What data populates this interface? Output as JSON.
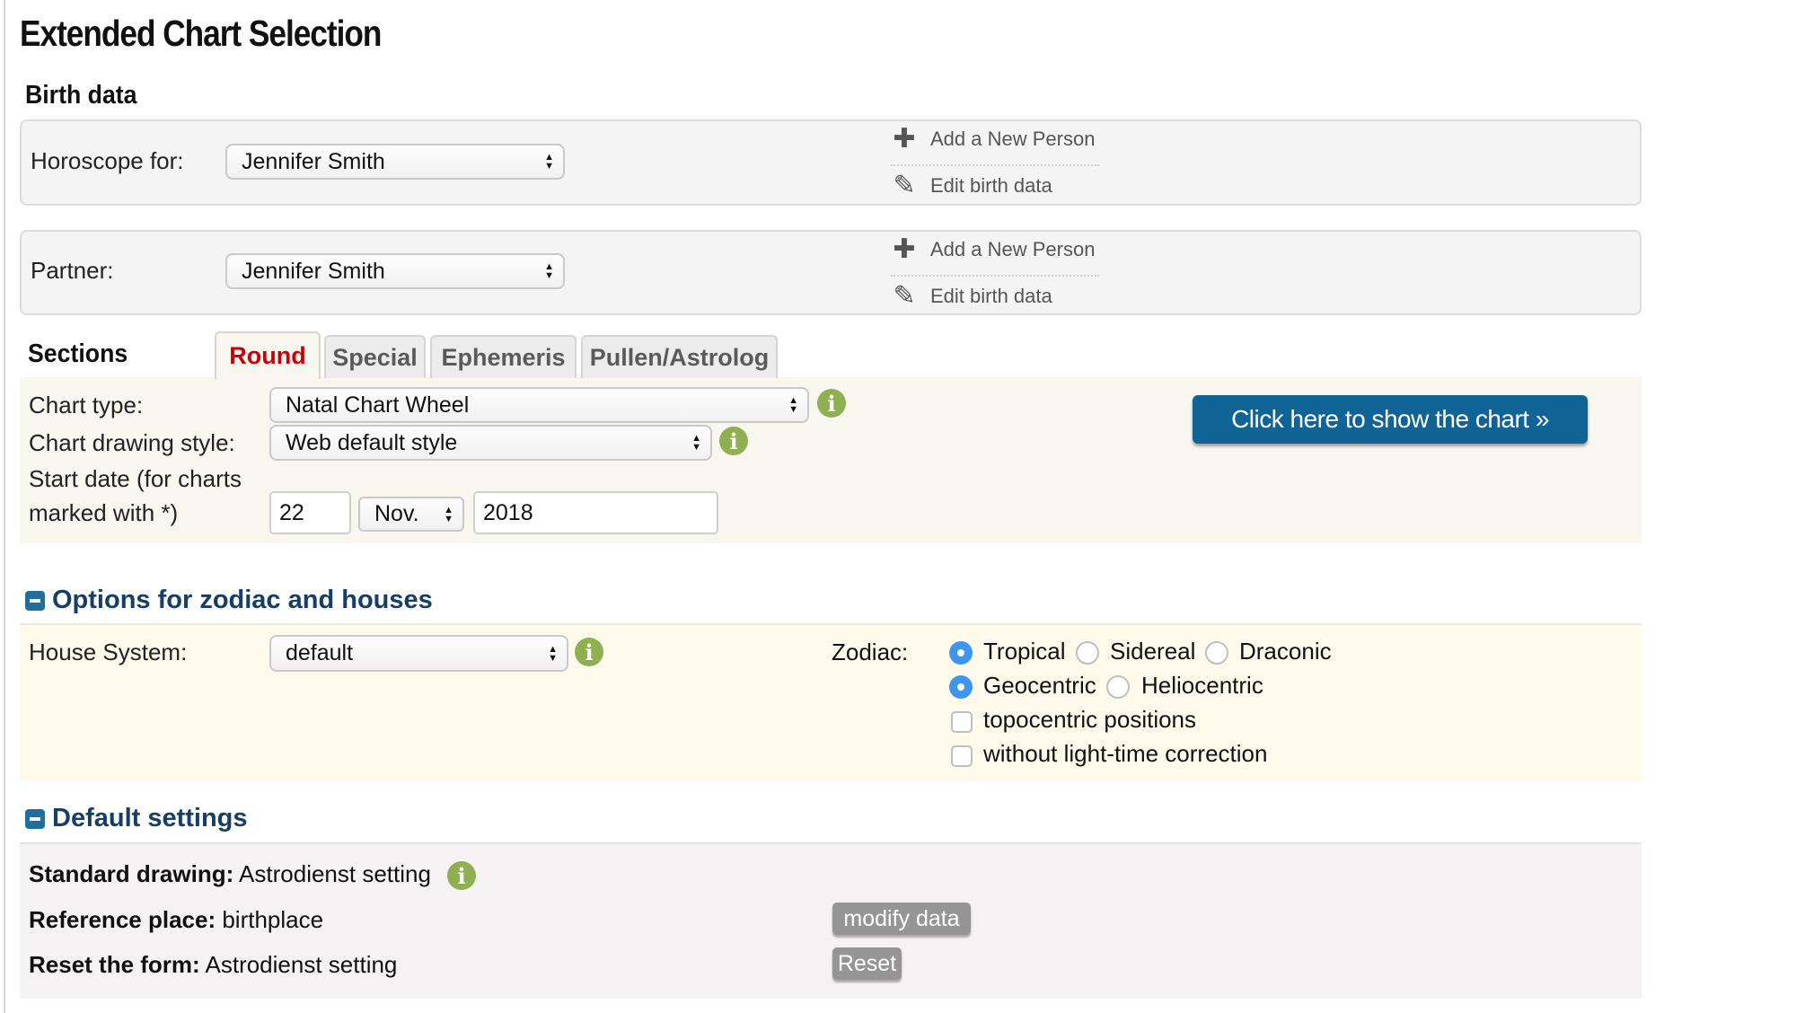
{
  "page": {
    "title": "Extended Chart Selection"
  },
  "birth_data": {
    "heading": "Birth data",
    "horoscope": {
      "label": "Horoscope for:",
      "value": "Jennifer Smith",
      "add_person": "Add a New Person",
      "edit": "Edit birth data"
    },
    "partner": {
      "label": "Partner:",
      "value": "Jennifer Smith",
      "add_person": "Add a New Person",
      "edit": "Edit birth data"
    }
  },
  "sections": {
    "label": "Sections",
    "tabs": [
      {
        "label": "Round",
        "active": true
      },
      {
        "label": "Special",
        "active": false
      },
      {
        "label": "Ephemeris",
        "active": false
      },
      {
        "label": "Pullen/Astrolog",
        "active": false
      }
    ],
    "chart_type": {
      "label": "Chart type:",
      "value": "Natal Chart Wheel"
    },
    "drawing_style": {
      "label": "Chart drawing style:",
      "value": "Web default style"
    },
    "start_date": {
      "label_line1": "Start date (for charts",
      "label_line2": "marked with *)",
      "day": "22",
      "month": "Nov.",
      "year": "2018"
    },
    "show_button": "Click here to show the chart »"
  },
  "zodiac_options": {
    "heading": "Options for zodiac and houses",
    "house_system": {
      "label": "House System:",
      "value": "default"
    },
    "zodiac_label": "Zodiac:",
    "zodiac_type": [
      {
        "label": "Tropical",
        "checked": true
      },
      {
        "label": "Sidereal",
        "checked": false
      },
      {
        "label": "Draconic",
        "checked": false
      }
    ],
    "centric": [
      {
        "label": "Geocentric",
        "checked": true
      },
      {
        "label": "Heliocentric",
        "checked": false
      }
    ],
    "checkboxes": [
      {
        "label": "topocentric positions",
        "checked": false
      },
      {
        "label": "without light-time correction",
        "checked": false
      }
    ]
  },
  "default_settings": {
    "heading": "Default settings",
    "standard_drawing": {
      "key": "Standard drawing:",
      "value": "Astrodienst setting"
    },
    "reference_place": {
      "key": "Reference place:",
      "value": "birthplace",
      "button": "modify data"
    },
    "reset_form": {
      "key": "Reset the form:",
      "value": "Astrodienst setting",
      "button": "Reset"
    }
  },
  "colors": {
    "accent_blue": "#106495",
    "active_tab": "#c4000a",
    "info_green": "#8fb050",
    "section_heading": "#163e66"
  }
}
